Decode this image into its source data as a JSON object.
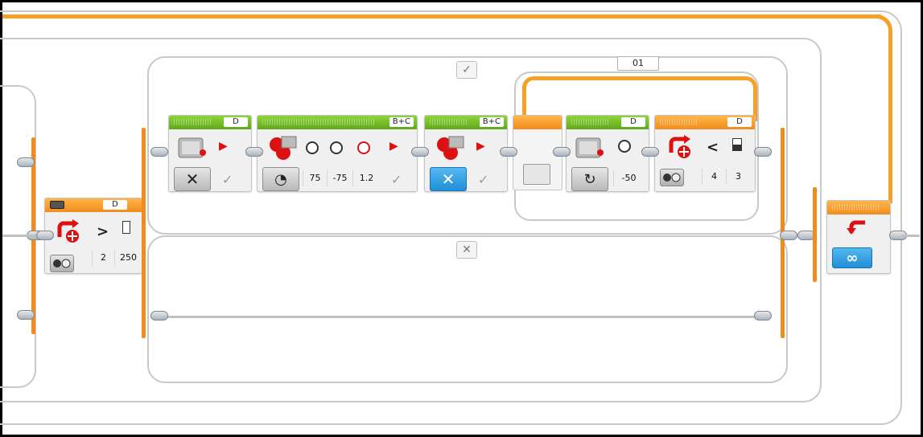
{
  "canvas": {
    "background": "#ffffff",
    "wire_orange": "#f7a026",
    "wire_gray": "#c0c0c0",
    "action_header_color": "#6cbf24",
    "flow_header_color": "#f7a026"
  },
  "switch_case_labels": {
    "true_tab": "✓",
    "false_tab": "✕"
  },
  "switch_block": {
    "port": "D",
    "comparison": ">",
    "mode_icon": "compare-icon",
    "threshold_a": "2",
    "threshold_b": "250"
  },
  "loop_counter": "01",
  "blocks": [
    {
      "id": "medium-motor-off",
      "port": "D",
      "mode_icon": "stop-x-icon",
      "icon": "medium-motor-icon"
    },
    {
      "id": "move-tank-seconds",
      "port": "B+C",
      "power_left": "75",
      "power_right": "-75",
      "seconds": "1.2",
      "icon": "move-tank-icon"
    },
    {
      "id": "move-tank-off",
      "port": "B+C",
      "mode_icon": "stop-x-icon",
      "icon": "move-tank-icon"
    },
    {
      "id": "medium-motor-on",
      "port": "D",
      "power": "-50",
      "icon": "medium-motor-icon"
    },
    {
      "id": "wait-motor-rotation",
      "port": "D",
      "comparison": "<",
      "compare_type": "4",
      "threshold": "3",
      "icon": "motor-rotation-icon"
    }
  ],
  "loop_block": {
    "mode": "∞",
    "icon": "loop-arrow-icon"
  }
}
